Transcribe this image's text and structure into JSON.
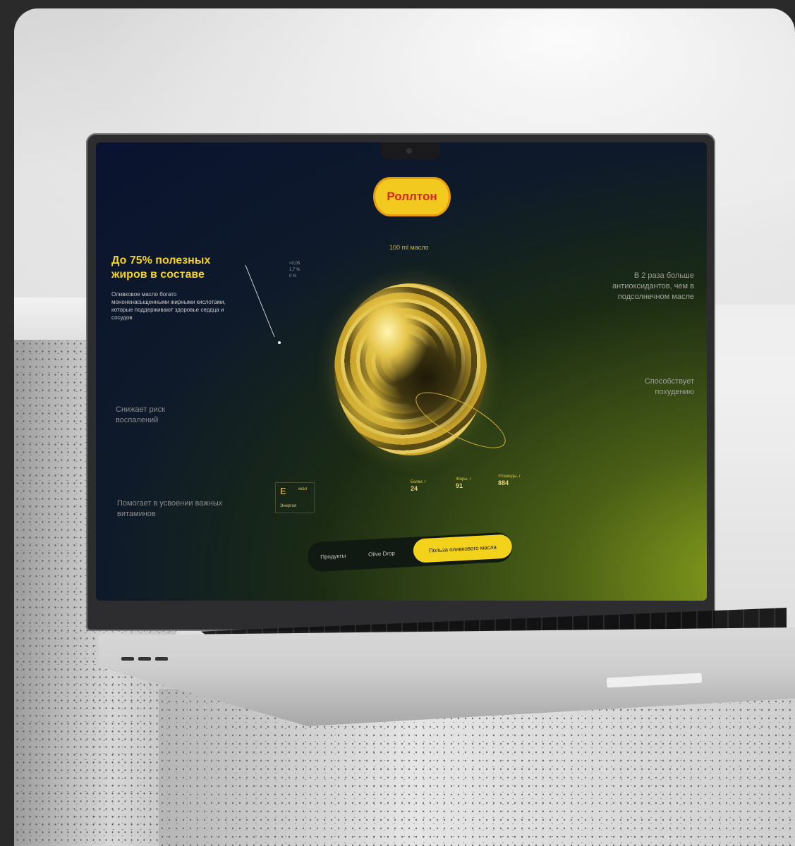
{
  "brand": {
    "logo_text": "Роллтон"
  },
  "hero": {
    "tag": "100 ml масло",
    "headline": "До 75% полезных жиров в составе",
    "headline_desc": "Оливковое масло богато мононенасыщенными жирными кислотами, которые поддерживают здоровье сердца и сосудов",
    "small_stats": [
      "<0,05",
      "1,7 %",
      "0 %"
    ]
  },
  "left_points": {
    "p1": "Снижает риск воспалений",
    "p2": "Помогает в усвоении важных витаминов"
  },
  "right_points": {
    "p1": "В 2 раза больше антиоксидантов, чем в подсолнечном масле",
    "p2": "Способствует похудению"
  },
  "energy": {
    "symbol": "E",
    "unit": "ккал",
    "label": "Энергия"
  },
  "nutrients": [
    {
      "name": "Белки, г",
      "value": "24"
    },
    {
      "name": "Жиры, г",
      "value": "91"
    },
    {
      "name": "Углеводы, г",
      "value": "884"
    }
  ],
  "nav": {
    "item1": "Продукты",
    "item2": "Olive Drop",
    "cta": "Польза оливкового масла"
  },
  "colors": {
    "accent_yellow": "#f2d21a",
    "logo_red": "#d8261a",
    "screen_bg_dark": "#0a1330",
    "screen_bg_green": "#8ea61e"
  }
}
